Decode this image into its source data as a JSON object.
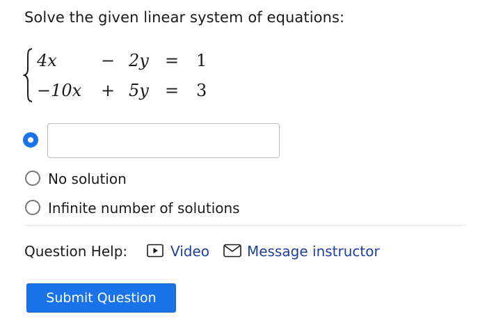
{
  "question": {
    "prompt": "Solve the given linear system of equations:",
    "system": {
      "rows": [
        {
          "x_term": "4x",
          "op": "−",
          "y_term": "2y",
          "eq": "=",
          "rhs": "1"
        },
        {
          "x_term": "−10x",
          "op": "+",
          "y_term": "5y",
          "eq": "=",
          "rhs": "3"
        }
      ]
    }
  },
  "answer": {
    "input_value": "",
    "options": [
      {
        "label": "",
        "type": "input",
        "selected": true
      },
      {
        "label": "No solution",
        "type": "radio",
        "selected": false
      },
      {
        "label": "Infinite number of solutions",
        "type": "radio",
        "selected": false
      }
    ]
  },
  "help": {
    "label": "Question Help:",
    "video_label": "Video",
    "message_label": "Message instructor",
    "icons": [
      "video-icon",
      "envelope-icon"
    ]
  },
  "submit": {
    "label": "Submit Question"
  },
  "colors": {
    "accent": "#1a73e8",
    "link": "#1d3fa0",
    "text": "#1a1a1a",
    "border": "#b8b8b8"
  }
}
